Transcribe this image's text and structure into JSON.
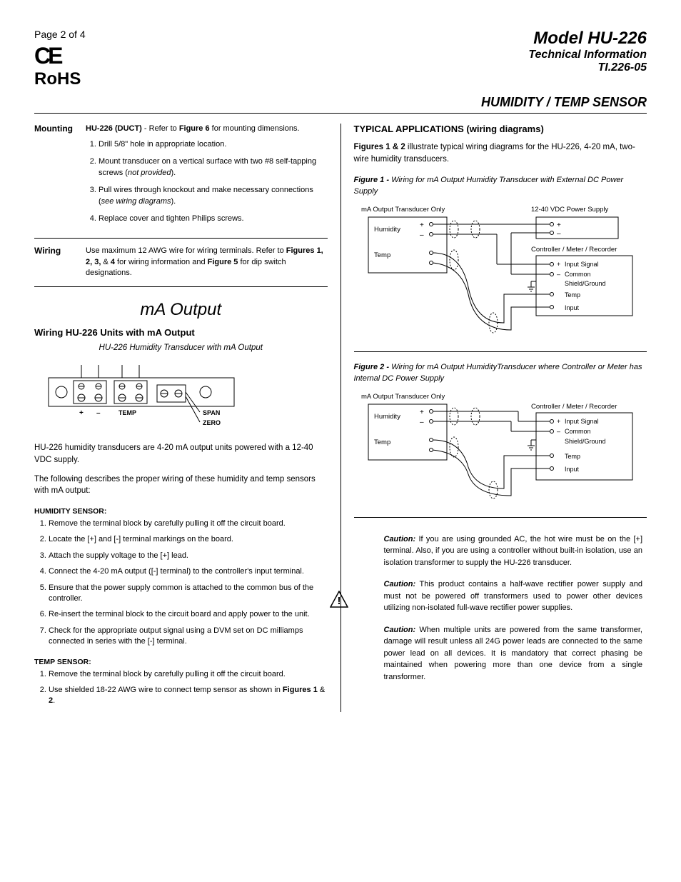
{
  "header": {
    "page_label": "Page 2 of 4",
    "model": "Model HU-226",
    "subtitle": "Technical Information",
    "docnum": "TI.226-05",
    "sensor_title": "HUMIDITY / TEMP SENSOR",
    "ce": "CE",
    "rohs": "RoHS"
  },
  "mounting": {
    "label": "Mounting",
    "intro_b": "HU-226 (DUCT)",
    "intro_mid": " - Refer to ",
    "intro_fig": "Figure 6",
    "intro_end": " for mounting dimensions.",
    "steps": [
      "Drill 5/8\" hole in appropriate location.",
      "Mount transducer on a vertical surface with two #8 self-tapping screws (not provided).",
      "Pull wires through knockout and make necessary connections (see wiring diagrams).",
      "Replace cover and tighten Philips screws."
    ]
  },
  "wiring_sec": {
    "label": "Wiring",
    "text_a": "Use maximum 12 AWG wire for wiring terminals.  Refer to ",
    "text_b": "Figures 1, 2, 3, ",
    "text_c": "& ",
    "text_d": "4",
    "text_e": " for wiring information and ",
    "text_f": "Figure 5",
    "text_g": " for dip switch designations."
  },
  "ma": {
    "title": "mA Output",
    "sub": "Wiring HU-226 Units with mA Output",
    "figcap": "HU-226 Humidity Transducer with mA Output",
    "diag_labels": {
      "plus": "+",
      "minus": "–",
      "temp": "TEMP",
      "span": "SPAN",
      "zero": "ZERO"
    },
    "p1": "HU-226 humidity transducers are 4-20 mA output units powered with a 12-40 VDC supply.",
    "p2": "The following describes the proper wiring of these humidity and temp sensors with mA output:",
    "hum_h": "HUMIDITY SENSOR:",
    "hum_steps": [
      "Remove the terminal block by carefully pulling it off the circuit board.",
      "Locate the [+] and [-] terminal markings on the board.",
      "Attach the supply voltage to the [+] lead.",
      "Connect the 4-20 mA output ([-] terminal) to the controller's input terminal.",
      "Ensure that the power supply common is attached to the common bus of the controller.",
      "Re-insert the terminal block to the circuit board and apply power to the unit.",
      "Check for the appropriate output signal using a DVM set on DC milliamps connected in series with the [-] terminal."
    ],
    "temp_h": "TEMP SENSOR:",
    "temp_steps_1": "Remove the terminal block by carefully pulling it off the circuit board.",
    "temp_steps_2a": "Use shielded 18-22 AWG wire to connect temp sensor as shown in ",
    "temp_steps_2b": "Figures 1",
    "temp_steps_2c": " & ",
    "temp_steps_2d": "2",
    "temp_steps_2e": "."
  },
  "right": {
    "title": "TYPICAL APPLICATIONS (wiring diagrams)",
    "intro_a": "Figures 1 & 2",
    "intro_b": " illustrate typical wiring diagrams for the HU-226, 4-20 mA, two-wire humidity transducers.",
    "fig1_a": "Figure 1 - ",
    "fig1_b": "Wiring for mA Output Humidity Transducer with External DC Power Supply",
    "fig2_a": "Figure 2 - ",
    "fig2_b": "Wiring for mA Output HumidityTransducer where Controller or Meter has Internal DC Power Supply",
    "d": {
      "trans": "mA Output Transducer Only",
      "hum": "Humidity",
      "temp": "Temp",
      "ps": "12-40 VDC Power Supply",
      "ctrl": "Controller / Meter / Recorder",
      "insig": "Input Signal",
      "common": "Common",
      "shield": "Shield/Ground",
      "t2": "Temp",
      "inp": "Input",
      "plus": "+",
      "minus": "–"
    },
    "caution1_a": "Caution:",
    "caution1_b": "  If you are using grounded AC, the hot wire must be on the [+] terminal. Also, if you are using a controller without built-in isolation, use an isolation transformer to supply the HU-226 transducer.",
    "caution2_a": "Caution:",
    "caution2_b": "  This product contains a half-wave rectifier power supply and must not be powered off transformers used to power other devices utilizing non-isolated full-wave rectifier power supplies.",
    "caution3_a": "Caution:",
    "caution3_b": "  When multiple units are powered from the same transformer, damage will result unless all 24G power leads are connected to the same power lead on all devices. It is mandatory that correct phasing be maintained when powering more than one device from a single transformer."
  }
}
